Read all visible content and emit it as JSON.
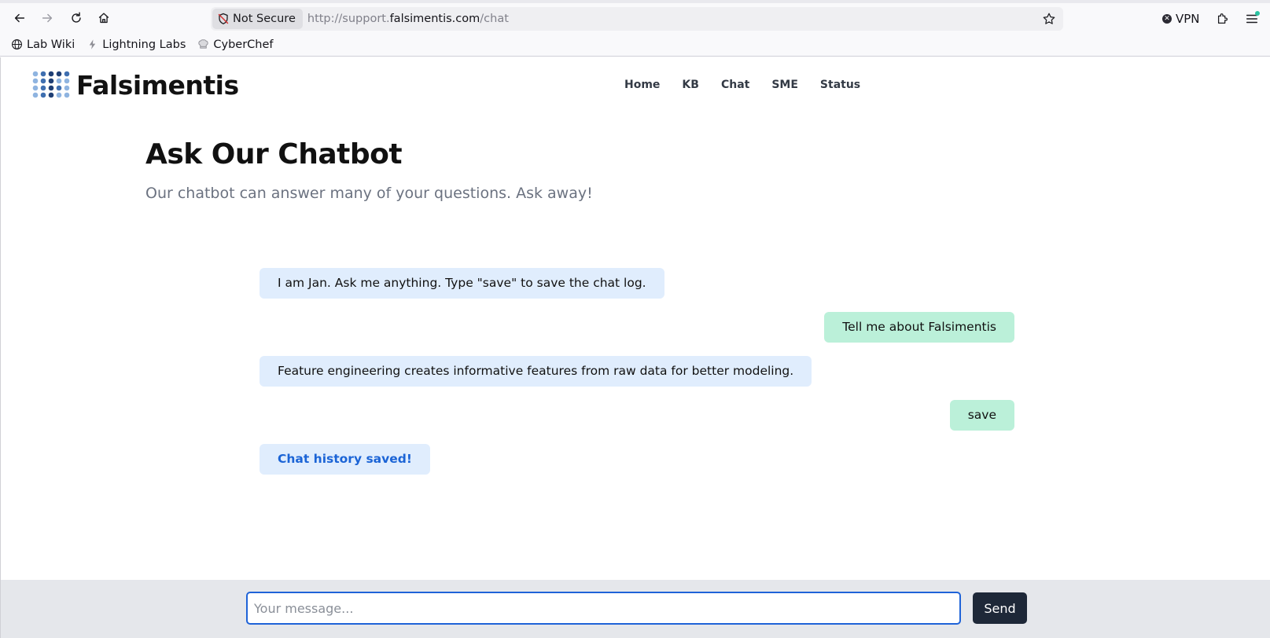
{
  "browser": {
    "security_label": "Not Secure",
    "url_scheme": "http://support.",
    "url_host": "falsimentis.com",
    "url_path": "/chat",
    "vpn_label": "VPN",
    "bookmarks": [
      {
        "label": "Lab Wiki",
        "icon": "globe-icon"
      },
      {
        "label": "Lightning Labs",
        "icon": "lightning-icon"
      },
      {
        "label": "CyberChef",
        "icon": "chef-hat-icon"
      }
    ]
  },
  "site": {
    "logo_text": "Falsimentis",
    "nav": [
      "Home",
      "KB",
      "Chat",
      "SME",
      "Status"
    ]
  },
  "hero": {
    "title": "Ask Our Chatbot",
    "subtitle": "Our chatbot can answer many of your questions. Ask away!"
  },
  "chat": {
    "messages": [
      {
        "role": "bot",
        "text": "I am Jan. Ask me anything. Type \"save\" to save the chat log."
      },
      {
        "role": "user",
        "text": "Tell me about Falsimentis"
      },
      {
        "role": "bot",
        "text": "Feature engineering creates informative features from raw data for better modeling."
      },
      {
        "role": "user",
        "text": "save"
      },
      {
        "role": "system",
        "text": "Chat history saved!"
      }
    ]
  },
  "composer": {
    "placeholder": "Your message...",
    "send_label": "Send"
  },
  "colors": {
    "bot_bubble": "#e0edfd",
    "user_bubble": "#bbf0d9",
    "system_text": "#1b64d6",
    "send_button": "#1e2838",
    "input_border": "#1f63d8"
  }
}
